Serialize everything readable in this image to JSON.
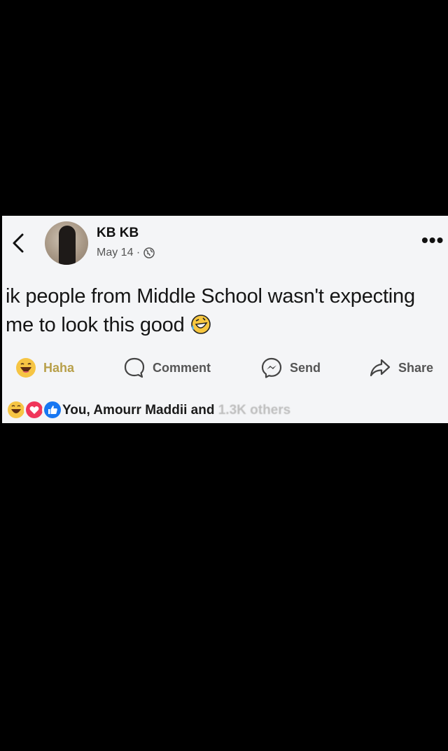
{
  "post": {
    "author": "KB KB",
    "date": "May 14 ·",
    "text": "ik people from Middle School wasn't expecting me to look this good",
    "actions": {
      "haha": "Haha",
      "comment": "Comment",
      "send": "Send",
      "share": "Share"
    },
    "reactions_summary": "You, Amourr Maddii and",
    "reactions_blurred": "1.3K others"
  },
  "colors": {
    "haha_label": "#b8a04a",
    "background": "#000000",
    "card": "#f4f5f7"
  },
  "icons": [
    "back-chevron-icon",
    "globe-icon",
    "more-dots-icon",
    "rofl-emoji-icon",
    "haha-emoji-icon",
    "comment-icon",
    "messenger-icon",
    "share-icon",
    "love-reaction-icon",
    "like-reaction-icon"
  ]
}
